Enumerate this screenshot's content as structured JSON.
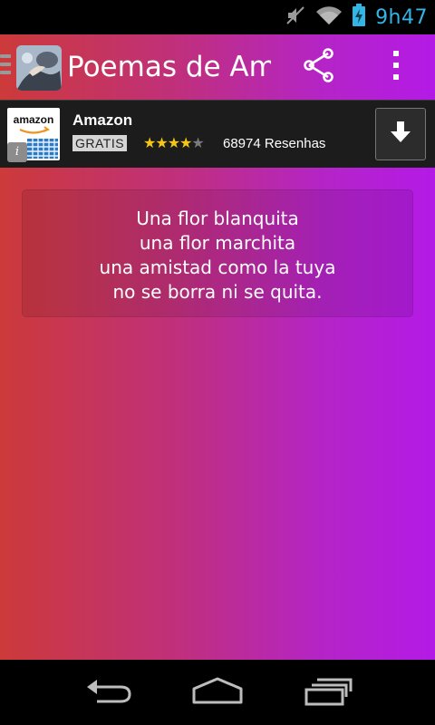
{
  "status_bar": {
    "time": "9h47",
    "icons": [
      "mute-icon",
      "wifi-icon",
      "battery-charging-icon"
    ],
    "accent_color": "#33b5e5"
  },
  "action_bar": {
    "title": "Poemas de Ami",
    "icons": [
      "drawer-indicator-icon",
      "app-icon",
      "share-icon",
      "overflow-menu-icon"
    ]
  },
  "ad": {
    "logo_text": "amazon",
    "title": "Amazon",
    "badge": "GRATIS",
    "rating": 4,
    "rating_max": 5,
    "reviews": "68974 Resenhas",
    "icons": [
      "amazon-logo-icon",
      "ad-info-icon",
      "download-icon"
    ]
  },
  "poem": {
    "lines": [
      "Una flor blanquita",
      "una flor marchita",
      "una amistad como la tuya",
      "no se borra ni se quita."
    ]
  },
  "nav_bar": {
    "icons": [
      "back-icon",
      "home-icon",
      "recent-apps-icon"
    ]
  },
  "colors": {
    "gradient_start": "#cc3a3a",
    "gradient_end": "#b41ae6",
    "star": "#f5c518"
  }
}
